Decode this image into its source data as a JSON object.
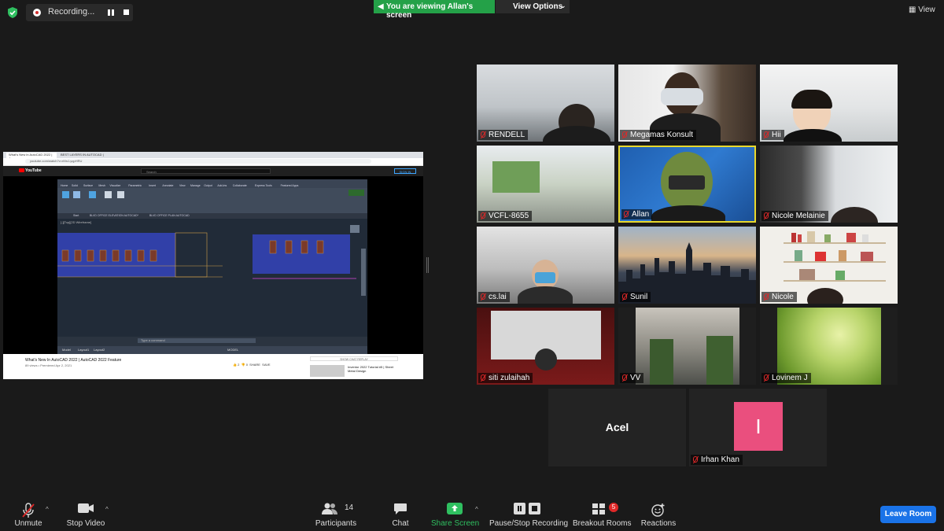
{
  "top": {
    "recording_label": "Recording...",
    "viewing_label": "You are viewing Allan's screen",
    "view_options_label": "View Options",
    "view_label": "View"
  },
  "shared_screen": {
    "browser_tabs": [
      "What's New In AutoCAD 2022 | Au",
      "BEST LAYERS IN AUTOCAD |"
    ],
    "url": "youtube.com/watch?v=rMnJ-yqpHRU",
    "yt_search_placeholder": "Search",
    "yt_logo": "YouTube",
    "yt_signin": "SIGN IN",
    "cad_menu": [
      "Home",
      "Solid",
      "Surface",
      "Mesh",
      "Visualize",
      "Parametric",
      "Insert",
      "Annotate",
      "View",
      "Manage",
      "Output",
      "Add-ins",
      "Collaborate",
      "Express Tools",
      "Featured Apps"
    ],
    "cad_tabs": [
      "Start",
      "BLVD OFFICE ELEVATION AUTOCAD*",
      "BLVD OFFICE PLAN AUTOCAD"
    ],
    "cad_viewport_label": "[-][Top][2D Wireframe]",
    "cad_command_placeholder": "Type a command",
    "cad_layout_tabs": [
      "Model",
      "Layout1",
      "Layout2"
    ],
    "cad_model_label": "MODEL",
    "video_title": "What's New In AutoCAD 2022 | AutoCAD 2022 Feature",
    "video_meta": "89 views • Premiered Apr 2, 2021",
    "video_actions": {
      "likes": "2",
      "dislikes": "0",
      "share": "SHARE",
      "save": "SAVE"
    },
    "side_label": "SHOW CHAT REPLAY",
    "side_video_title": "Inventor 2022 Tutorial #5 | Sheet Metal Design"
  },
  "participants": [
    {
      "name": "RENDELL",
      "bg": "office"
    },
    {
      "name": "Megamas Konsult",
      "bg": "vr"
    },
    {
      "name": "Hii",
      "bg": "office2"
    },
    {
      "name": "VCFL-8655",
      "bg": "room"
    },
    {
      "name": "Allan",
      "bg": "blueprint"
    },
    {
      "name": "Nicole Melainie",
      "bg": "window"
    },
    {
      "name": "cs.lai",
      "bg": "office3"
    },
    {
      "name": "Sunil",
      "bg": "city"
    },
    {
      "name": "Nicole",
      "bg": "shelf"
    },
    {
      "name": "siti zulaihah",
      "bg": "cinema"
    },
    {
      "name": "VV",
      "bg": "street"
    },
    {
      "name": "Lovinem J",
      "bg": "grass"
    }
  ],
  "no_video": [
    {
      "name": "Acel"
    },
    {
      "name": "Irhan Khan",
      "initial": "I"
    }
  ],
  "toolbar": {
    "unmute": "Unmute",
    "stop_video": "Stop Video",
    "participants": "Participants",
    "participants_count": "14",
    "chat": "Chat",
    "share_screen": "Share Screen",
    "pause_stop_recording": "Pause/Stop Recording",
    "breakout_rooms": "Breakout Rooms",
    "breakout_badge": "5",
    "reactions": "Reactions",
    "leave": "Leave Room"
  },
  "colors": {
    "accent_green": "#24a148",
    "leave_blue": "#1a73e8",
    "active_speaker": "#e8d82c",
    "avatar_pink": "#ea4f7e",
    "muted_red": "#e02828"
  }
}
